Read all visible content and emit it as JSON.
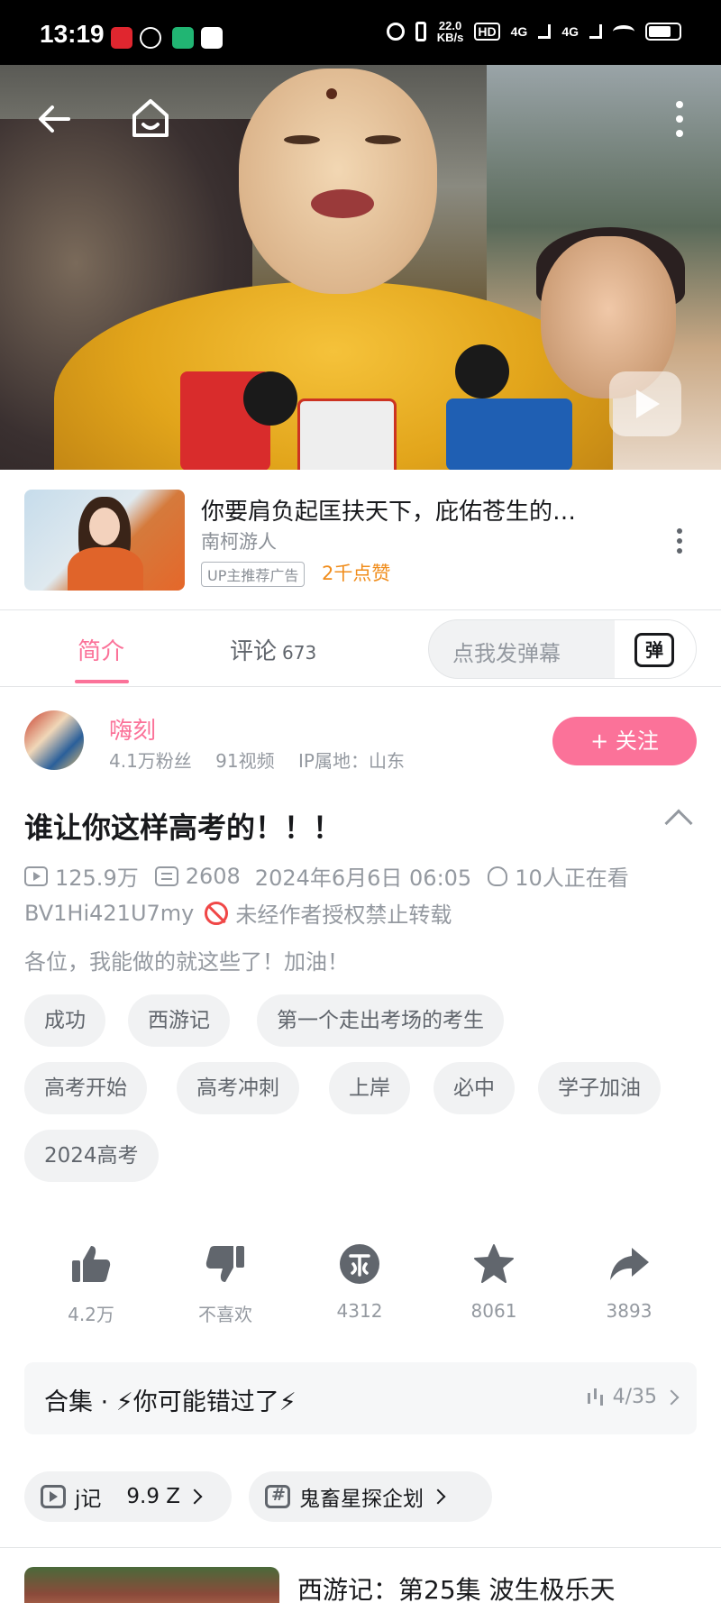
{
  "status_bar": {
    "time": "13:19",
    "net_speed_value": "22.0",
    "net_speed_unit": "KB/s",
    "signal1": "4G",
    "signal2": "4G",
    "hd": "HD"
  },
  "video": {
    "back_icon": "back-arrow-icon",
    "home_icon": "home-icon",
    "more_icon": "more-vertical-icon"
  },
  "ad": {
    "title": "你要肩负起匡扶天下，庇佑苍生的…",
    "author": "南柯游人",
    "badge": "UP主推荐广告",
    "likes": "2千点赞"
  },
  "tabs": {
    "intro": "简介",
    "comments": "评论",
    "comments_count": "673",
    "danmu_placeholder": "点我发弹幕",
    "danmu_icon_text": "弹"
  },
  "uploader": {
    "name": "嗨刻",
    "fans": "4.1万粉丝",
    "videos": "91视频",
    "ip": "IP属地：山东",
    "follow": "+ 关注"
  },
  "video_info": {
    "title": "谁让你这样高考的！！！",
    "views": "125.9万",
    "danmaku": "2608",
    "date": "2024年6月6日 06:05",
    "watching": "10人正在看",
    "bvid": "BV1Hi421U7my",
    "repost_notice": "未经作者授权禁止转载",
    "description": "各位，我能做的就这些了！加油！"
  },
  "tags": [
    "成功",
    "西游记",
    "第一个走出考场的考生",
    "高考开始",
    "高考冲刺",
    "上岸",
    "必中",
    "学子加油",
    "2024高考"
  ],
  "actions": {
    "like": "4.2万",
    "dislike": "不喜欢",
    "coin": "4312",
    "favorite": "8061",
    "share": "3893"
  },
  "collection": {
    "title": "合集 · ⚡你可能错过了⚡",
    "progress": "4/35"
  },
  "chips": {
    "chip1_label": "j记",
    "chip1_value": "9.9 Z",
    "chip2_label": "鬼畜星探企划"
  },
  "related": {
    "title": "西游记：第25集 波生极乐天"
  },
  "colors": {
    "accent": "#fb7299",
    "orange": "#f08c1a",
    "gray": "#9499a0"
  }
}
